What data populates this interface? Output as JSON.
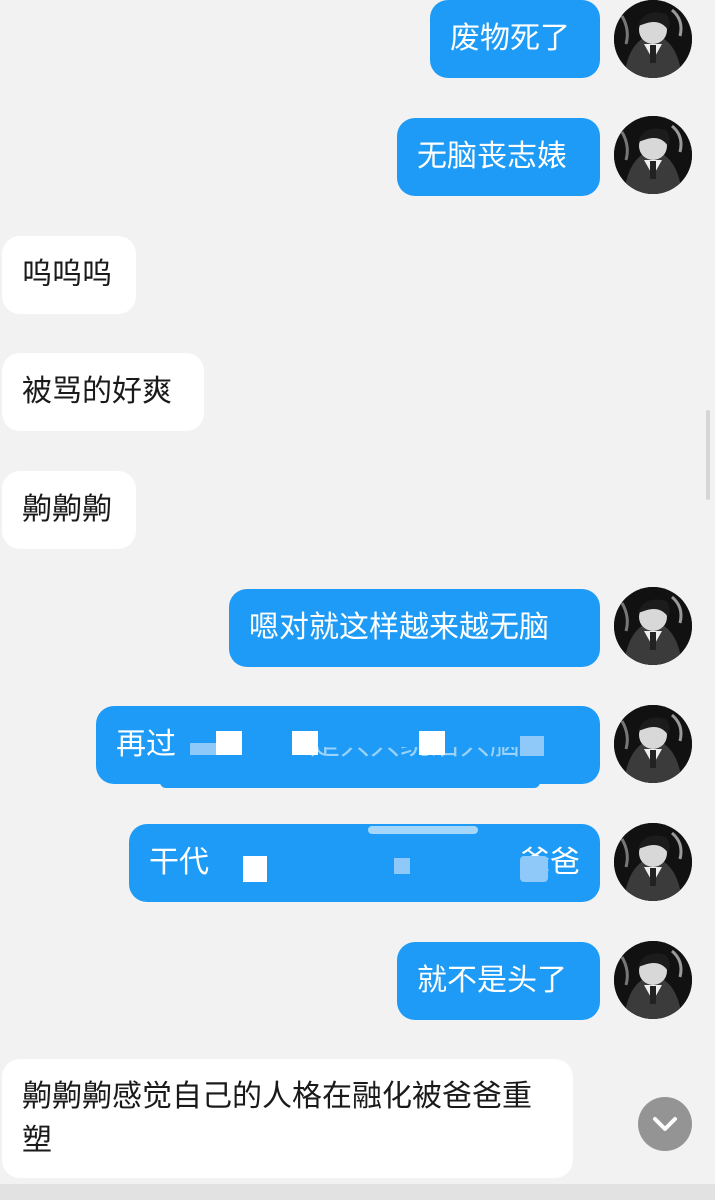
{
  "messages": [
    {
      "side": "out",
      "text": "废物死了"
    },
    {
      "side": "out",
      "text": "无脑丧志婊"
    },
    {
      "side": "in",
      "text": "呜呜呜"
    },
    {
      "side": "in",
      "text": "被骂的好爽"
    },
    {
      "side": "in",
      "text": "齁齁齁"
    },
    {
      "side": "out",
      "text": "嗯对就这样越来越无脑"
    },
    {
      "side": "out",
      "text": "再过",
      "note_partial": "就是只只统治只脑"
    },
    {
      "side": "out",
      "text": "干代",
      "tail": "爸爸"
    },
    {
      "side": "out",
      "text": "就不是头了"
    },
    {
      "side": "in",
      "text": "齁齁齁感觉自己的人格在融化被爸爸重塑"
    }
  ],
  "partial": {
    "m7_tail": "是只只统治只脑"
  },
  "icons": {
    "avatar": "user-avatar-icon",
    "scroll": "chevron-down-icon"
  },
  "colors": {
    "outgoing_bubble": "#1d9bf6",
    "incoming_bubble": "#ffffff",
    "background": "#f2f2f2"
  }
}
